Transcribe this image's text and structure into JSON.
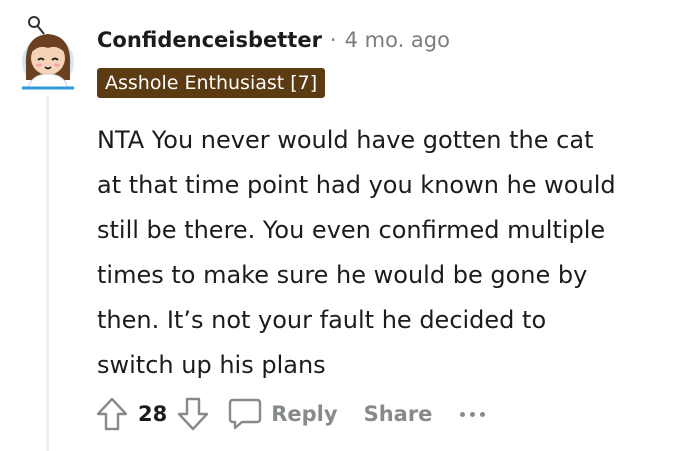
{
  "comment": {
    "author": "Confidenceisbetter",
    "separator": "·",
    "time": "4 mo. ago",
    "flair": "Asshole Enthusiast [7]",
    "body_lines": [
      "NTA You never would have gotten the cat",
      "at that time point had you known he would",
      "still be there. You even confirmed multiple",
      "times to make sure he would be gone by",
      "then. It’s not your fault he decided to",
      "switch up his plans"
    ]
  },
  "actions": {
    "score": "28",
    "reply_label": "Reply",
    "share_label": "Share",
    "icons": {
      "upvote": "upvote-arrow-icon",
      "downvote": "downvote-arrow-icon",
      "reply": "speech-bubble-icon",
      "more": "ellipsis-icon"
    }
  },
  "colors": {
    "flair_background": "#5c3a12",
    "muted_text": "#7c7c7c",
    "action_text": "#878a8c"
  }
}
